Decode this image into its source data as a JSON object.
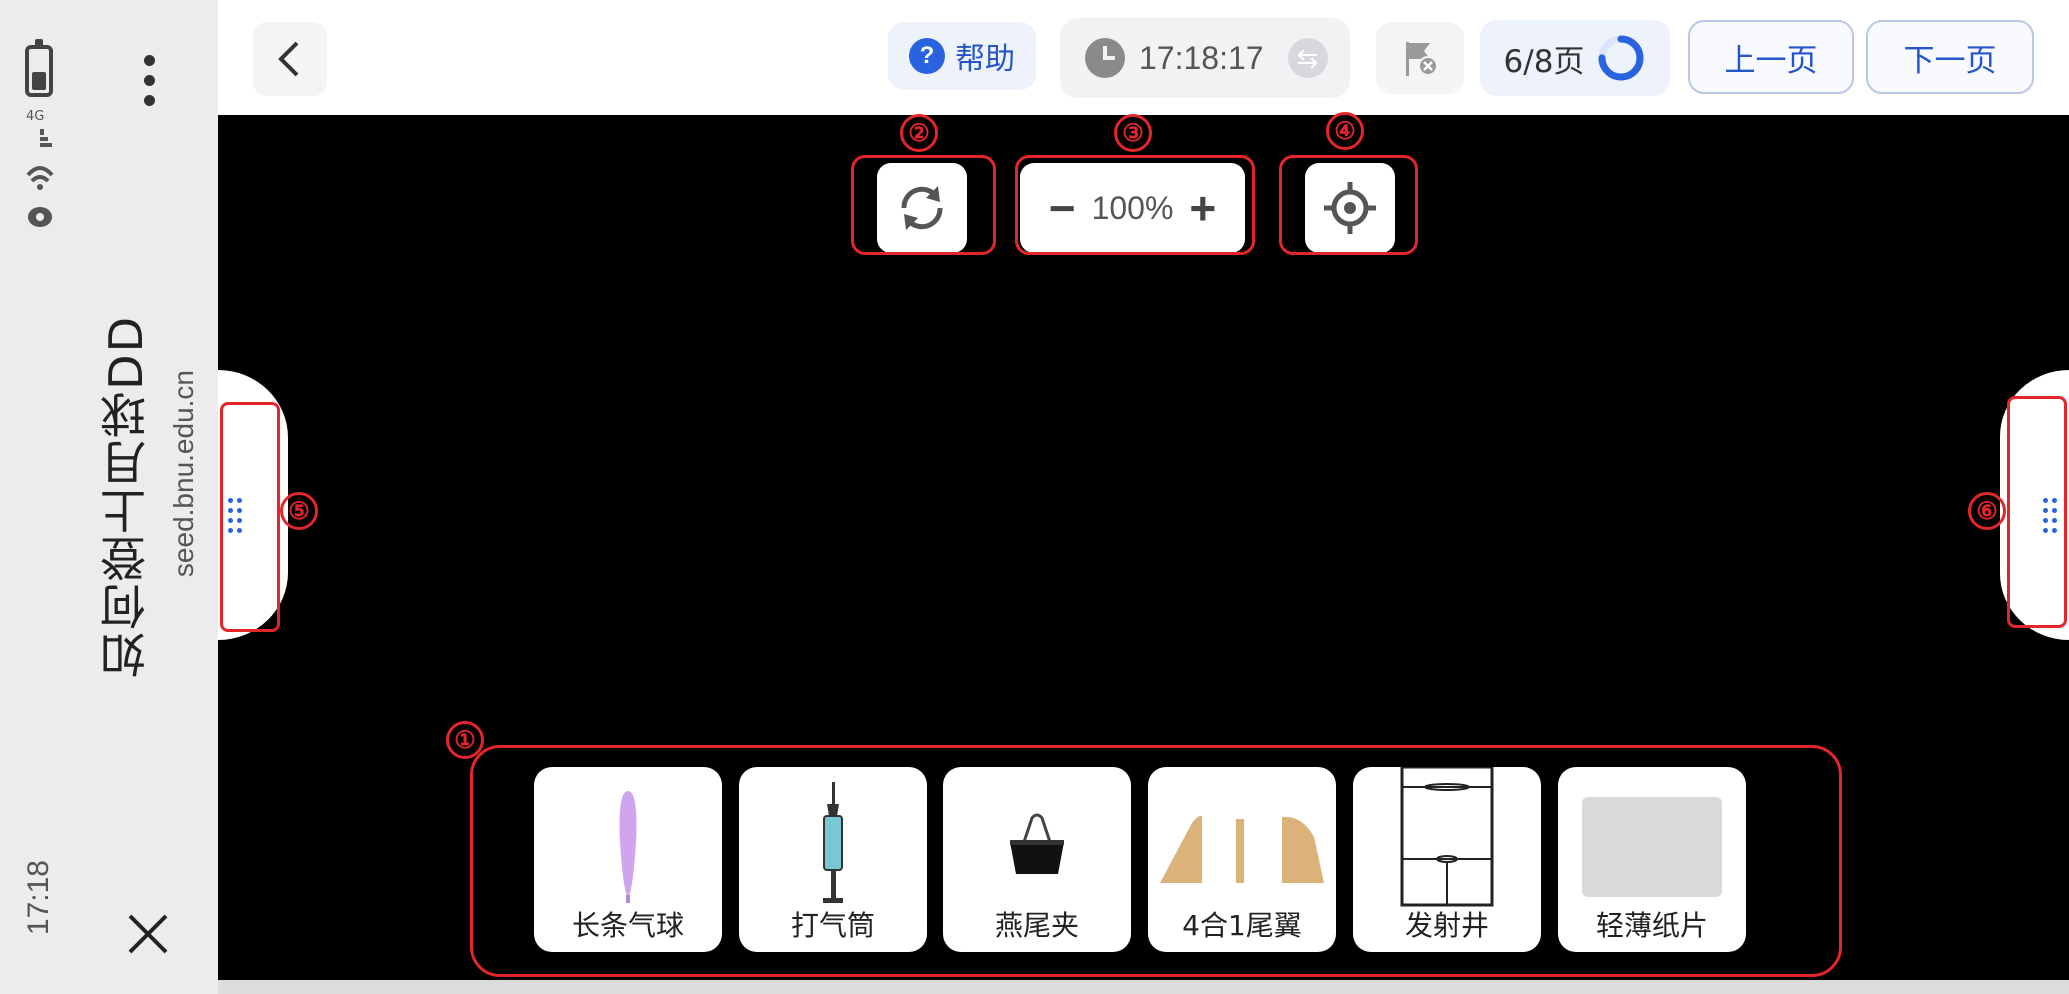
{
  "system": {
    "app_title": "如何登上月球DD",
    "app_url": "seed.bnu.edu.cn",
    "time": "17:18",
    "signal_text": "4G"
  },
  "header": {
    "help_label": "帮助",
    "timer": "17:18:17",
    "page_indicator": "6/8页",
    "page_progress": 0.75,
    "prev_label": "上一页",
    "next_label": "下一页"
  },
  "canvas_controls": {
    "zoom_value": "100%"
  },
  "annotations": [
    "①",
    "②",
    "③",
    "④",
    "⑤",
    "⑥"
  ],
  "tools": [
    {
      "label": "长条气球",
      "icon": "long-balloon-icon"
    },
    {
      "label": "打气筒",
      "icon": "air-pump-icon"
    },
    {
      "label": "燕尾夹",
      "icon": "binder-clip-icon"
    },
    {
      "label": "4合1尾翼",
      "icon": "tail-fins-icon"
    },
    {
      "label": "发射井",
      "icon": "launch-well-icon"
    },
    {
      "label": "轻薄纸片",
      "icon": "paper-sheet-icon"
    }
  ],
  "colors": {
    "accent": "#2963e0",
    "annotation_red": "#e4262b",
    "stage": "#000000"
  }
}
